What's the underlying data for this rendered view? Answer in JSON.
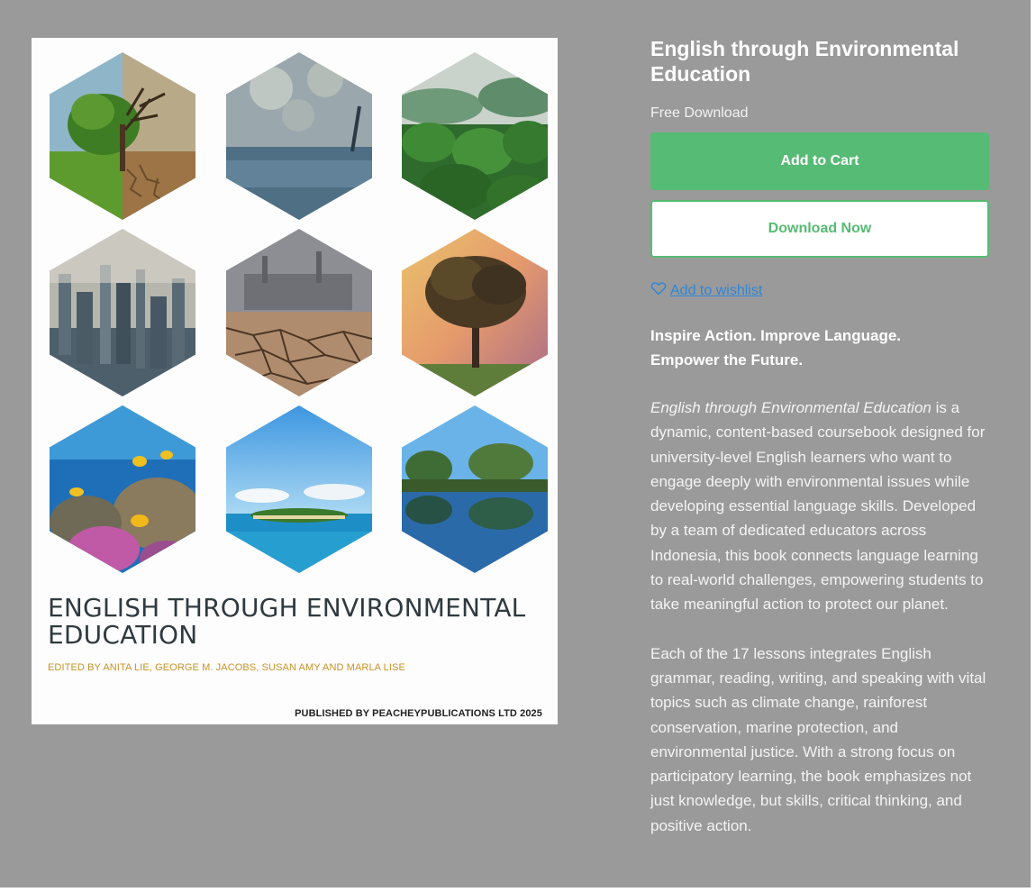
{
  "cover": {
    "title_line1": "ENGLISH THROUGH ENVIRONMENTAL",
    "title_line2": "EDUCATION",
    "editors": "EDITED BY ANITA LIE, GEORGE M. JACOBS, SUSAN AMY AND MARLA LISE",
    "publisher": "PUBLISHED BY PEACHEYPUBLICATIONS LTD 2025",
    "images": [
      "tree-half-dead",
      "rain-on-water",
      "misty-rainforest",
      "smoggy-city",
      "cracked-earth-factory",
      "sunset-tree",
      "coral-reef",
      "tropical-island",
      "river-reflection"
    ]
  },
  "product": {
    "title": "English through Environmental Education",
    "price": "Free Download",
    "add_to_cart": "Add to Cart",
    "download_now": "Download Now",
    "wishlist": "Add to wishlist",
    "tagline_line1": "Inspire Action. Improve Language.",
    "tagline_line2": "Empower the Future.",
    "desc1_em": "English through Environmental Education",
    "desc1_rest": " is a dynamic, content-based coursebook designed for university-level English learners who want to engage deeply with environmental issues while developing essential language skills. Developed by a team of dedicated educators across Indonesia, this book connects language learning to real-world challenges, empowering students to take meaningful action to protect our planet.",
    "desc2": "Each of the 17 lessons integrates English grammar, reading, writing, and speaking with vital topics such as climate change, rainforest conservation, marine protection, and environmental justice. With a strong focus on participatory learning, the book emphasizes not just knowledge, but skills, critical thinking, and positive action."
  },
  "colors": {
    "background": "#9a9a9a",
    "accent_green": "#56bb74",
    "link_blue": "#2f86d6",
    "cover_gold": "#c99326"
  },
  "icons": {
    "wishlist": "heart-outline-icon"
  }
}
